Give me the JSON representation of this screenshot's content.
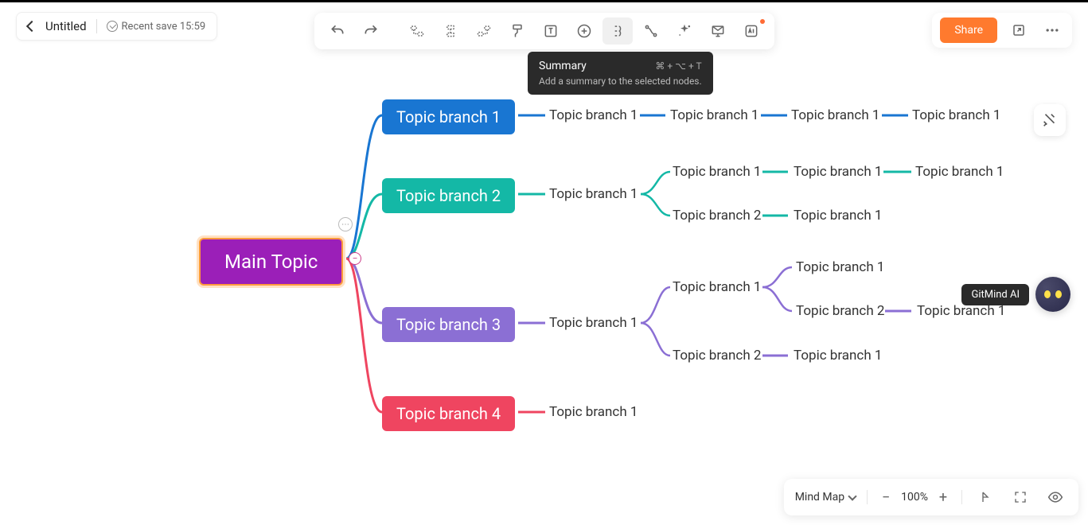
{
  "doc": {
    "title": "Untitled",
    "save_status": "Recent save 15:59"
  },
  "toolbar": {
    "undo": "undo",
    "redo": "redo"
  },
  "tooltip": {
    "title": "Summary",
    "shortcut": "⌘ + ⌥ + T",
    "desc": "Add a summary to the selected nodes."
  },
  "actions": {
    "share": "Share"
  },
  "ai": {
    "label": "GitMind AI"
  },
  "bottom": {
    "view": "Mind Map",
    "zoom": "100%"
  },
  "colors": {
    "main": "#9b1fb8",
    "b1": "#1976d2",
    "b2": "#14b8a6",
    "b3": "#8b6fd4",
    "b4": "#ef4560"
  },
  "mindmap": {
    "root": "Main Topic",
    "branches": [
      {
        "label": "Topic branch 1",
        "color": "b1",
        "children": [
          {
            "label": "Topic branch 1",
            "children": []
          }
        ],
        "flat": [
          "Topic branch 1",
          "Topic branch 1",
          "Topic branch 1",
          "Topic branch 1"
        ]
      },
      {
        "label": "Topic branch 2",
        "color": "b2",
        "children": [
          {
            "label": "Topic branch 1",
            "children": [
              {
                "label": "Topic branch 1",
                "children": [
                  {
                    "label": "Topic branch 1"
                  },
                  {
                    "label": "Topic branch 1"
                  }
                ]
              },
              {
                "label": "Topic branch 2",
                "children": [
                  {
                    "label": "Topic branch 1"
                  }
                ]
              }
            ]
          }
        ]
      },
      {
        "label": "Topic branch 3",
        "color": "b3",
        "children": [
          {
            "label": "Topic branch 1",
            "children": [
              {
                "label": "Topic branch 1",
                "children": [
                  {
                    "label": "Topic branch 1"
                  },
                  {
                    "label": "Topic branch 2",
                    "children": [
                      {
                        "label": "Topic branch 1"
                      }
                    ]
                  }
                ]
              },
              {
                "label": "Topic branch 2",
                "children": [
                  {
                    "label": "Topic branch 1"
                  }
                ]
              }
            ]
          }
        ]
      },
      {
        "label": "Topic branch 4",
        "color": "b4",
        "children": [
          {
            "label": "Topic branch 1"
          }
        ]
      }
    ]
  }
}
